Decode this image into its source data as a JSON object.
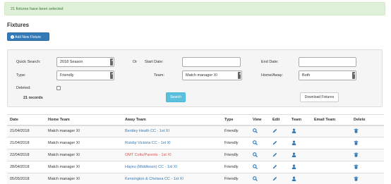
{
  "alert": {
    "text": "21 fixtures have been selected"
  },
  "page": {
    "title": "Fixtures",
    "add_button": "Add New Fixture"
  },
  "filters": {
    "quick_search_label": "Quick Search:",
    "quick_search_value": "2018 Season",
    "or_label": "Or",
    "start_date_label": "Start Date:",
    "start_date_value": "",
    "end_date_label": "End Date:",
    "end_date_value": "",
    "type_label": "Type:",
    "type_value": "Friendly",
    "team_label": "Team:",
    "team_value": "Match manager XI",
    "home_away_label": "Home/Away:",
    "home_away_value": "Both",
    "deleted_label": "Deleted:",
    "records": "21 records",
    "search_button": "Search",
    "download_button": "Download Fixtures"
  },
  "table": {
    "headers": [
      "Date",
      "Home Team",
      "Away Team",
      "Type",
      "View",
      "Edit",
      "Team",
      "Email Team",
      "Delete"
    ],
    "rows": [
      {
        "date": "21/04/2018",
        "home": "Match manager XI",
        "away": "Bentley Heath CC - 1st XI",
        "type": "Friendly",
        "away_color": "#337ab7"
      },
      {
        "date": "21/04/2018",
        "home": "Match manager XI",
        "away": "Ruislip Victoria CC - 1st XI",
        "type": "Friendly",
        "away_color": "#337ab7"
      },
      {
        "date": "22/04/2018",
        "home": "Match manager XI",
        "away": "OMT Colts/Parents - 1st XI",
        "type": "Friendly",
        "away_color": "#d9534f"
      },
      {
        "date": "28/04/2018",
        "home": "Match manager XI",
        "away": "Hayes (Middlesex) CC - 1st XI",
        "type": "Friendly",
        "away_color": "#337ab7"
      },
      {
        "date": "05/05/2018",
        "home": "Match manager XI",
        "away": "Kensington & Chelsea CC - 1st XI",
        "type": "Friendly",
        "away_color": "#337ab7"
      }
    ]
  },
  "icons": {
    "view": "search-icon",
    "edit": "pencil-icon",
    "team": "user-icon",
    "delete": "trash-icon",
    "add": "plus-circle-icon"
  },
  "colors": {
    "primary": "#337ab7",
    "info": "#5bc0de",
    "success_bg": "#dff0d8",
    "danger": "#d9534f"
  }
}
